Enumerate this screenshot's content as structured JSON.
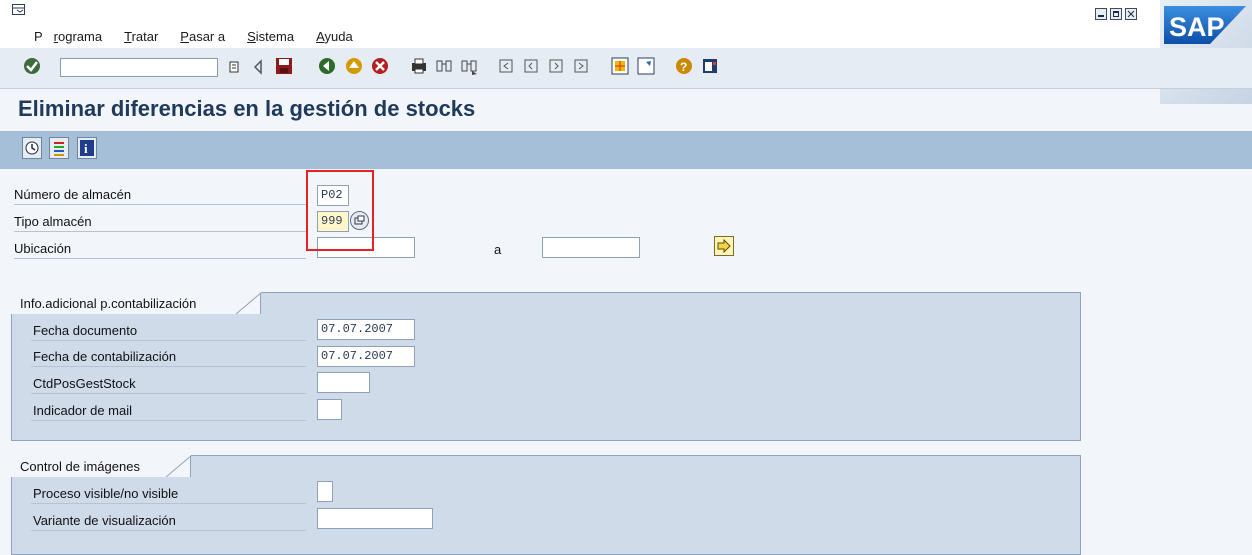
{
  "menu": {
    "items": [
      {
        "pre": "P",
        "u": "r",
        "post": "ograma"
      },
      {
        "pre": "",
        "u": "T",
        "post": "ratar"
      },
      {
        "pre": "",
        "u": "P",
        "post": "asar a"
      },
      {
        "pre": "",
        "u": "S",
        "post": "istema"
      },
      {
        "pre": "",
        "u": "A",
        "post": "yuda"
      }
    ]
  },
  "logo": {
    "text": "SAP"
  },
  "title": "Eliminar diferencias en la gestión de stocks",
  "fields": {
    "warehouse": {
      "label": "Número de almacén",
      "value": "P02"
    },
    "storage_type": {
      "label": "Tipo almacén",
      "value": "999"
    },
    "bin": {
      "label": "Ubicación",
      "value": "",
      "to_label": "a",
      "to_value": ""
    }
  },
  "posting_group": {
    "title": "Info.adicional p.contabilización",
    "doc_date": {
      "label": "Fecha documento",
      "value": "07.07.2007"
    },
    "post_date": {
      "label": "Fecha de contabilización",
      "value": "07.07.2007"
    },
    "qty_items": {
      "label": "CtdPosGestStock",
      "value": ""
    },
    "mail_ind": {
      "label": "Indicador de mail",
      "value": ""
    }
  },
  "display_group": {
    "title": "Control de imágenes",
    "process_visible": {
      "label": "Proceso visible/no visible",
      "value": ""
    },
    "display_variant": {
      "label": "Variante de visualización",
      "value": ""
    }
  }
}
